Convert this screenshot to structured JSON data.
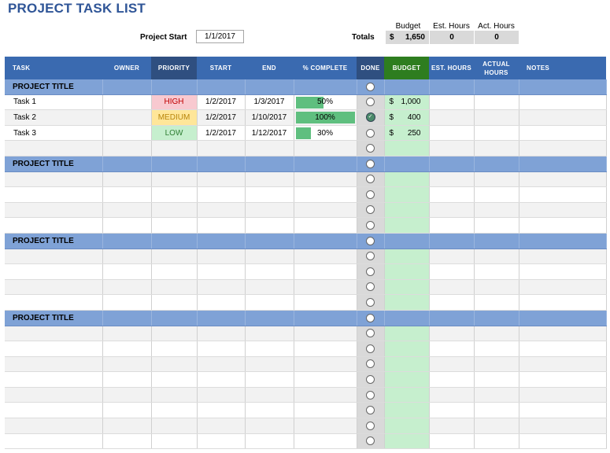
{
  "title": "PROJECT TASK LIST",
  "project_start": {
    "label": "Project Start",
    "value": "1/1/2017"
  },
  "totals": {
    "label": "Totals",
    "headers": [
      "Budget",
      "Est. Hours",
      "Act. Hours"
    ],
    "budget_currency": "$",
    "budget": "1,650",
    "est_hours": "0",
    "act_hours": "0"
  },
  "columns": [
    "TASK",
    "OWNER",
    "PRIORITY",
    "START",
    "END",
    "% COMPLETE",
    "DONE",
    "BUDGET",
    "EST. HOURS",
    "ACTUAL HOURS",
    "NOTES"
  ],
  "priority_colors": {
    "HIGH": {
      "bg": "#f8c9d0",
      "fg": "#c00000"
    },
    "MEDIUM": {
      "bg": "#ffe699",
      "fg": "#b8860b"
    },
    "LOW": {
      "bg": "#c6efce",
      "fg": "#2e7d32"
    }
  },
  "sections": [
    {
      "title": "PROJECT TITLE",
      "tasks": [
        {
          "task": "Task 1",
          "priority": "HIGH",
          "start": "1/2/2017",
          "end": "1/3/2017",
          "complete": 50,
          "complete_label": "50%",
          "done": false,
          "budget": "1,000"
        },
        {
          "task": "Task 2",
          "priority": "MEDIUM",
          "start": "1/2/2017",
          "end": "1/10/2017",
          "complete": 100,
          "complete_label": "100%",
          "done": true,
          "budget": "400"
        },
        {
          "task": "Task 3",
          "priority": "LOW",
          "start": "1/2/2017",
          "end": "1/12/2017",
          "complete": 30,
          "complete_label": "30%",
          "done": false,
          "budget": "250"
        }
      ],
      "blank_rows": 1
    },
    {
      "title": "PROJECT TITLE",
      "tasks": [],
      "blank_rows": 4
    },
    {
      "title": "PROJECT TITLE",
      "tasks": [],
      "blank_rows": 4
    },
    {
      "title": "PROJECT TITLE",
      "tasks": [],
      "blank_rows": 8
    }
  ],
  "currency": "$"
}
